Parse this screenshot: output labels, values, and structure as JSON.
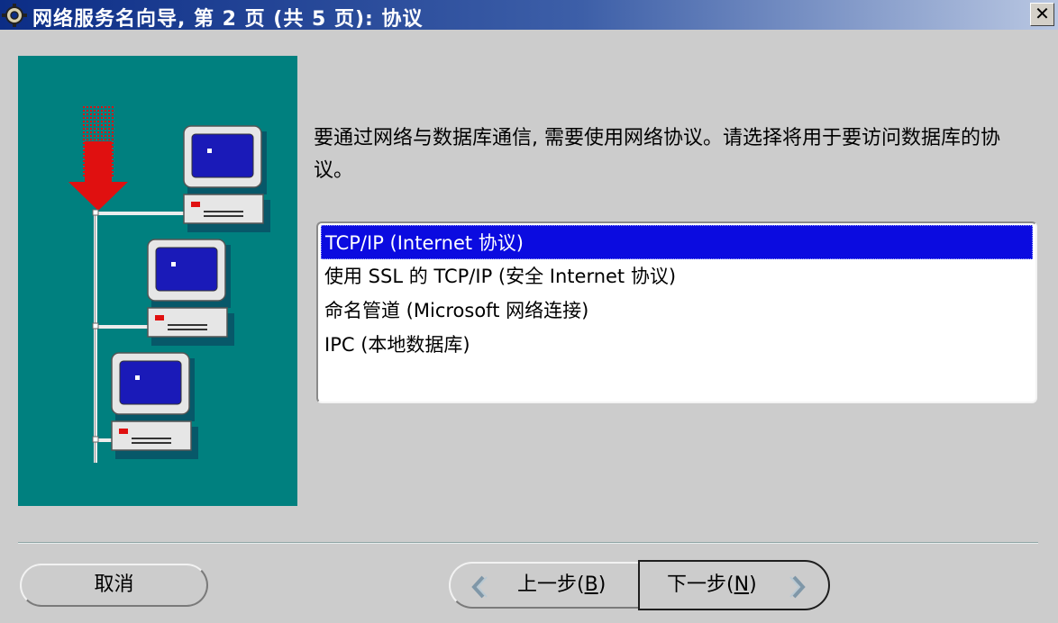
{
  "window": {
    "title": "网络服务名向导, 第 2 页 (共 5 页): 协议",
    "close_glyph": "✕",
    "icon": "gear-wizard-icon"
  },
  "illustration": {
    "background": "#00807f",
    "arrow_color": "#e01010",
    "screen_color": "#1a1ab8",
    "description_icons": [
      "arrow-down-icon",
      "computer-icon"
    ]
  },
  "main": {
    "description": "要通过网络与数据库通信, 需要使用网络协议。请选择将用于要访问数据库的协议。"
  },
  "protocols": {
    "items": [
      {
        "label": "TCP/IP (Internet 协议)",
        "selected": true
      },
      {
        "label": "使用 SSL 的 TCP/IP (安全 Internet 协议)",
        "selected": false
      },
      {
        "label": "命名管道 (Microsoft 网络连接)",
        "selected": false
      },
      {
        "label": "IPC (本地数据库)",
        "selected": false
      }
    ],
    "selected_color": "#0b0be0"
  },
  "buttons": {
    "cancel": "取消",
    "back_text": "上一步(",
    "back_key": "B",
    "back_close": ")",
    "next_text": "下一步(",
    "next_key": "N",
    "next_close": ")"
  }
}
